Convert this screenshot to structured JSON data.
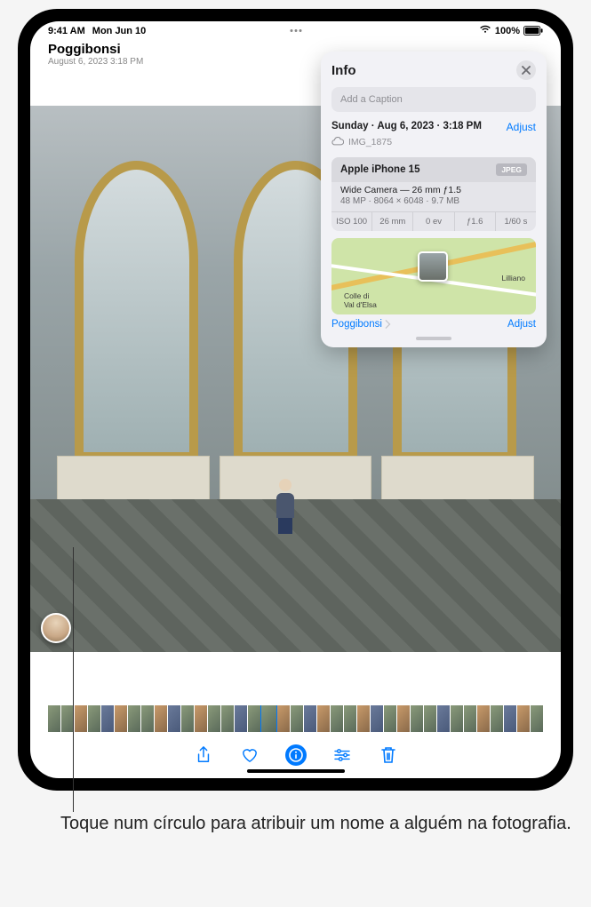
{
  "statusbar": {
    "time": "9:41 AM",
    "date": "Mon Jun 10",
    "battery_pct": "100%"
  },
  "header": {
    "title": "Poggibonsi",
    "subtitle": "August 6, 2023  3:18 PM"
  },
  "info_panel": {
    "title": "Info",
    "caption_placeholder": "Add a Caption",
    "date_line": "Sunday · Aug 6, 2023 · 3:18 PM",
    "adjust_label": "Adjust",
    "filename": "IMG_1875",
    "camera_model": "Apple iPhone 15",
    "format_badge": "JPEG",
    "lens": "Wide Camera — 26 mm ƒ1.5",
    "specs": "48 MP · 8064 × 6048 · 9.7 MB",
    "exif": {
      "iso": "ISO 100",
      "focal": "26 mm",
      "ev": "0 ev",
      "aperture": "ƒ1.6",
      "shutter": "1/60 s"
    },
    "map": {
      "place1": "Colle di\nVal d'Elsa",
      "place2": "Lilliano",
      "location_link": "Poggibonsi",
      "adjust_label": "Adjust"
    }
  },
  "annotation": {
    "caption": "Toque num círculo para atribuir um nome a alguém na fotografia."
  }
}
